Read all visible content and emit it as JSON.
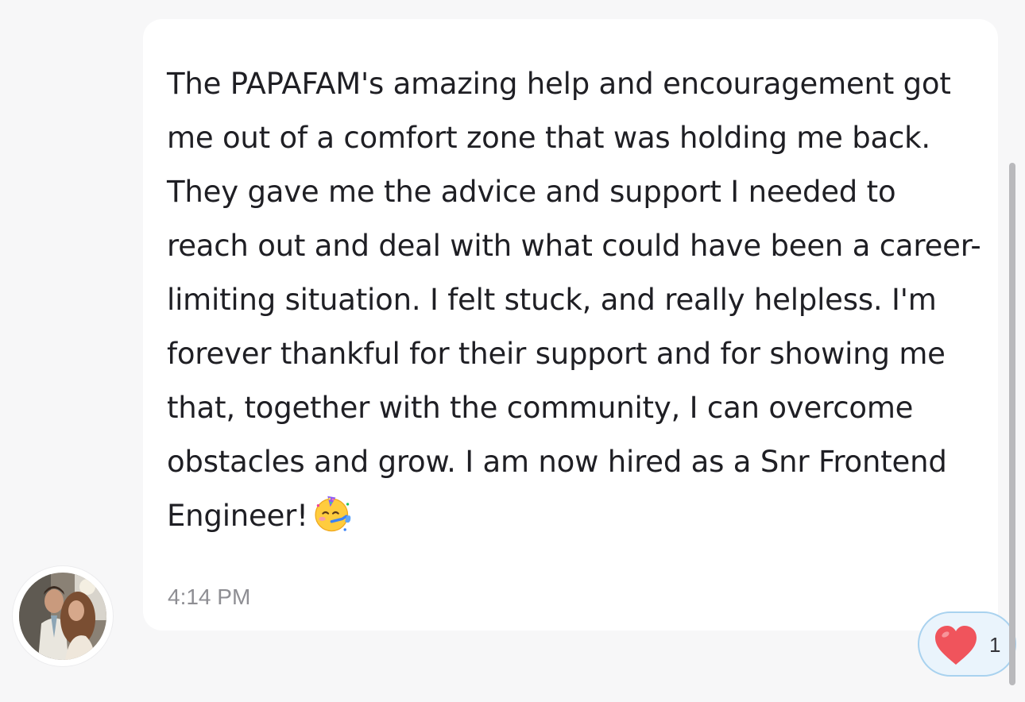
{
  "message": {
    "text": "The PAPAFAM's amazing help and encouragement got me out of a comfort zone that was holding me back. They gave me the advice and support I needed to reach out and deal with what could have been a career-limiting situation. I felt stuck, and really helpless. I'm forever thankful for their support and for showing me that, together with the community, I can overcome obstacles and grow. I am now hired as a Snr Frontend Engineer!",
    "emoji": "partying-face-icon",
    "timestamp": "4:14 PM"
  },
  "reaction": {
    "icon": "heart-icon",
    "count": "1",
    "heart_color": "#f0545c"
  },
  "colors": {
    "background": "#f7f7f8",
    "bubble": "#ffffff",
    "text": "#1f1f24",
    "timestamp": "#8e8e93",
    "reaction_border": "#a9d2ef"
  }
}
